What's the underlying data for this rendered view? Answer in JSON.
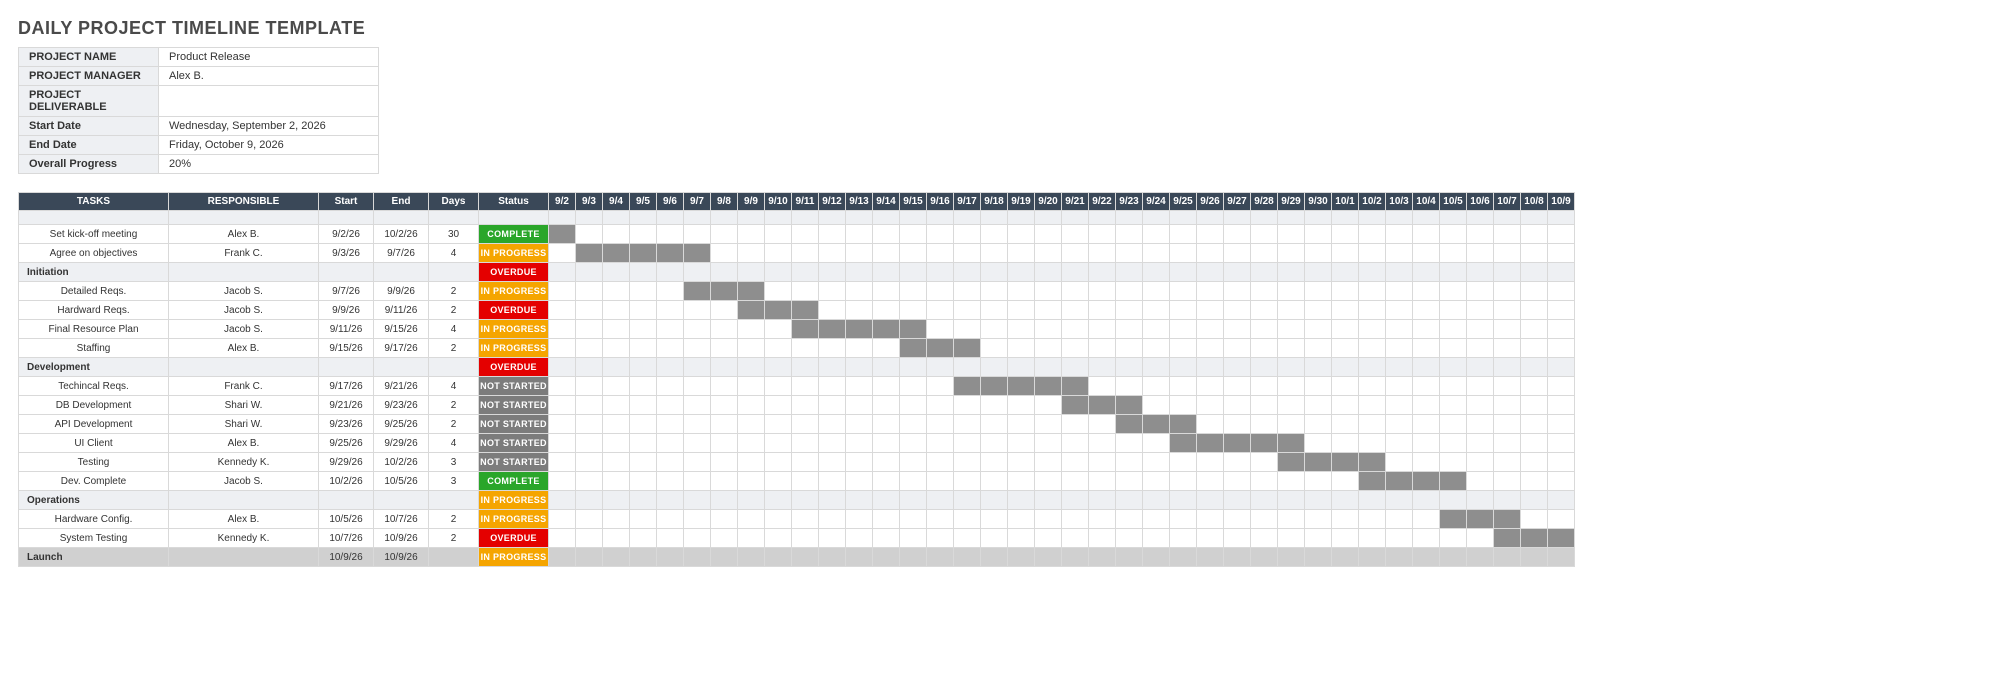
{
  "title": "DAILY PROJECT TIMELINE TEMPLATE",
  "meta": [
    {
      "label": "PROJECT NAME",
      "value": "Product Release"
    },
    {
      "label": "PROJECT MANAGER",
      "value": "Alex B."
    },
    {
      "label": "PROJECT DELIVERABLE",
      "value": ""
    },
    {
      "label": "Start Date",
      "value": "Wednesday, September 2, 2026"
    },
    {
      "label": "End Date",
      "value": "Friday, October 9, 2026"
    },
    {
      "label": "Overall Progress",
      "value": "20%"
    }
  ],
  "headers": {
    "tasks": "TASKS",
    "responsible": "RESPONSIBLE",
    "start": "Start",
    "end": "End",
    "days": "Days",
    "status": "Status"
  },
  "status_labels": {
    "complete": "COMPLETE",
    "inprogress": "IN PROGRESS",
    "overdue": "OVERDUE",
    "notstarted": "NOT STARTED"
  },
  "dates": [
    "9/2",
    "9/3",
    "9/4",
    "9/5",
    "9/6",
    "9/7",
    "9/8",
    "9/9",
    "9/10",
    "9/11",
    "9/12",
    "9/13",
    "9/14",
    "9/15",
    "9/16",
    "9/17",
    "9/18",
    "9/19",
    "9/20",
    "9/21",
    "9/22",
    "9/23",
    "9/24",
    "9/25",
    "9/26",
    "9/27",
    "9/28",
    "9/29",
    "9/30",
    "10/1",
    "10/2",
    "10/3",
    "10/4",
    "10/5",
    "10/6",
    "10/7",
    "10/8",
    "10/9"
  ],
  "rows": [
    {
      "type": "spacer"
    },
    {
      "type": "task",
      "task": "Set kick-off meeting",
      "resp": "Alex B.",
      "start": "9/2/26",
      "end": "10/2/26",
      "days": "30",
      "status": "complete",
      "bar_from": "9/2",
      "bar_to": "9/2"
    },
    {
      "type": "task",
      "task": "Agree on objectives",
      "resp": "Frank C.",
      "start": "9/3/26",
      "end": "9/7/26",
      "days": "4",
      "status": "inprogress",
      "bar_from": "9/3",
      "bar_to": "9/7"
    },
    {
      "type": "section",
      "task": "Initiation",
      "status": "overdue"
    },
    {
      "type": "task",
      "task": "Detailed Reqs.",
      "resp": "Jacob S.",
      "start": "9/7/26",
      "end": "9/9/26",
      "days": "2",
      "status": "inprogress",
      "bar_from": "9/7",
      "bar_to": "9/9"
    },
    {
      "type": "task",
      "task": "Hardward Reqs.",
      "resp": "Jacob S.",
      "start": "9/9/26",
      "end": "9/11/26",
      "days": "2",
      "status": "overdue",
      "bar_from": "9/9",
      "bar_to": "9/11"
    },
    {
      "type": "task",
      "task": "Final Resource Plan",
      "resp": "Jacob S.",
      "start": "9/11/26",
      "end": "9/15/26",
      "days": "4",
      "status": "inprogress",
      "bar_from": "9/11",
      "bar_to": "9/15"
    },
    {
      "type": "task",
      "task": "Staffing",
      "resp": "Alex B.",
      "start": "9/15/26",
      "end": "9/17/26",
      "days": "2",
      "status": "inprogress",
      "bar_from": "9/15",
      "bar_to": "9/17"
    },
    {
      "type": "section",
      "task": "Development",
      "status": "overdue"
    },
    {
      "type": "task",
      "task": "Techincal Reqs.",
      "resp": "Frank C.",
      "start": "9/17/26",
      "end": "9/21/26",
      "days": "4",
      "status": "notstarted",
      "bar_from": "9/17",
      "bar_to": "9/21"
    },
    {
      "type": "task",
      "task": "DB Development",
      "resp": "Shari W.",
      "start": "9/21/26",
      "end": "9/23/26",
      "days": "2",
      "status": "notstarted",
      "bar_from": "9/21",
      "bar_to": "9/23"
    },
    {
      "type": "task",
      "task": "API Development",
      "resp": "Shari W.",
      "start": "9/23/26",
      "end": "9/25/26",
      "days": "2",
      "status": "notstarted",
      "bar_from": "9/23",
      "bar_to": "9/25"
    },
    {
      "type": "task",
      "task": "UI Client",
      "resp": "Alex B.",
      "start": "9/25/26",
      "end": "9/29/26",
      "days": "4",
      "status": "notstarted",
      "bar_from": "9/25",
      "bar_to": "9/29"
    },
    {
      "type": "task",
      "task": "Testing",
      "resp": "Kennedy K.",
      "start": "9/29/26",
      "end": "10/2/26",
      "days": "3",
      "status": "notstarted",
      "bar_from": "9/29",
      "bar_to": "10/2"
    },
    {
      "type": "task",
      "task": "Dev. Complete",
      "resp": "Jacob S.",
      "start": "10/2/26",
      "end": "10/5/26",
      "days": "3",
      "status": "complete",
      "bar_from": "10/2",
      "bar_to": "10/5"
    },
    {
      "type": "section",
      "task": "Operations",
      "status": "inprogress"
    },
    {
      "type": "task",
      "task": "Hardware Config.",
      "resp": "Alex B.",
      "start": "10/5/26",
      "end": "10/7/26",
      "days": "2",
      "status": "inprogress",
      "bar_from": "10/5",
      "bar_to": "10/7"
    },
    {
      "type": "task",
      "task": "System Testing",
      "resp": "Kennedy K.",
      "start": "10/7/26",
      "end": "10/9/26",
      "days": "2",
      "status": "overdue",
      "bar_from": "10/7",
      "bar_to": "10/9"
    },
    {
      "type": "launch",
      "task": "Launch",
      "start": "10/9/26",
      "end": "10/9/26",
      "status": "inprogress"
    }
  ]
}
